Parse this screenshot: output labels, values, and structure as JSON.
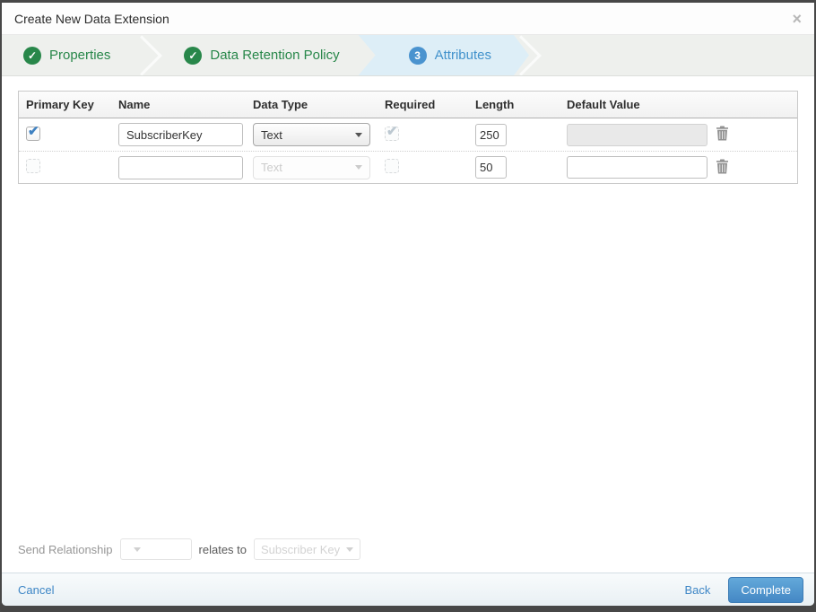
{
  "modal": {
    "title": "Create New Data Extension"
  },
  "icons": {
    "close": "×",
    "check": "✓"
  },
  "wizard": {
    "steps": [
      {
        "label": "Properties",
        "status": "complete"
      },
      {
        "label": "Data Retention Policy",
        "status": "complete"
      },
      {
        "label": "Attributes",
        "status": "active",
        "number": "3"
      }
    ]
  },
  "table": {
    "headers": [
      "Primary Key",
      "Name",
      "Data Type",
      "Required",
      "Length",
      "Default Value"
    ],
    "rows": [
      {
        "primary_key": true,
        "name": "SubscriberKey",
        "data_type": "Text",
        "data_type_disabled": false,
        "required": true,
        "required_disabled": true,
        "length": "250",
        "default_value": "",
        "default_disabled": true
      },
      {
        "primary_key": false,
        "name": "",
        "data_type": "Text",
        "data_type_disabled": true,
        "required": false,
        "required_disabled": true,
        "length": "50",
        "default_value": "",
        "default_disabled": false
      }
    ]
  },
  "send_relationship": {
    "label": "Send Relationship",
    "relates_to_label": "relates to",
    "source_value": "",
    "target_value": "Subscriber Key"
  },
  "footer": {
    "cancel_label": "Cancel",
    "back_label": "Back",
    "complete_label": "Complete"
  },
  "colors": {
    "accent_green": "#28874a",
    "accent_blue": "#4292cc",
    "active_step_bg": "#ddeef7",
    "primary_button": "#4f9bd5",
    "checkbox_check": "#3f81c1"
  }
}
